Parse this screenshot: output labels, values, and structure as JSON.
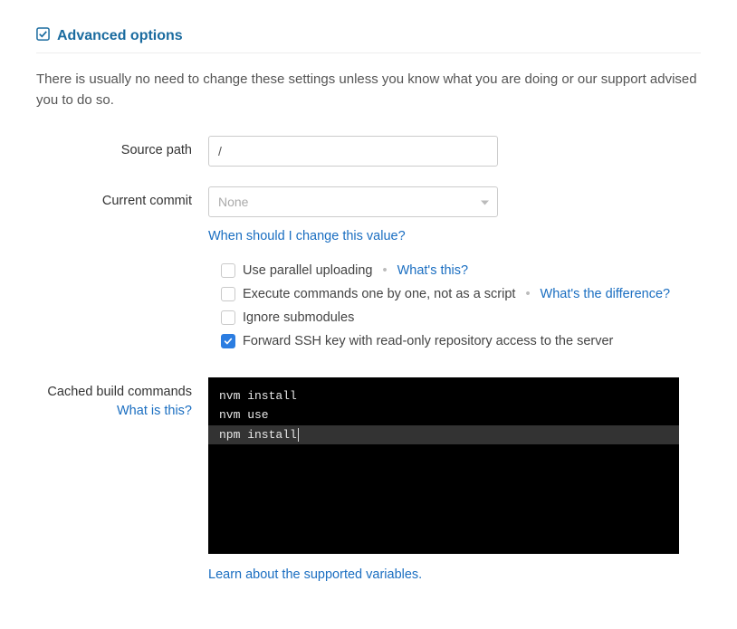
{
  "section": {
    "title": "Advanced options",
    "description": "There is usually no need to change these settings unless you know what you are doing or our support advised you to do so."
  },
  "fields": {
    "source_path": {
      "label": "Source path",
      "value": "/"
    },
    "current_commit": {
      "label": "Current commit",
      "placeholder": "None",
      "help_link": "When should I change this value?"
    },
    "options": {
      "parallel_upload": {
        "label": "Use parallel uploading",
        "help": "What's this?",
        "checked": false
      },
      "execute_one_by_one": {
        "label": "Execute commands one by one, not as a script",
        "help": "What's the difference?",
        "checked": false
      },
      "ignore_submodules": {
        "label": "Ignore submodules",
        "checked": false
      },
      "forward_ssh": {
        "label": "Forward SSH key with read-only repository access to the server",
        "checked": true
      }
    },
    "cached_build": {
      "label": "Cached build commands",
      "sub_link": "What is this?",
      "lines": [
        "nvm install",
        "nvm use",
        "npm install"
      ],
      "below_link": "Learn about the supported variables."
    }
  },
  "separator": "•"
}
